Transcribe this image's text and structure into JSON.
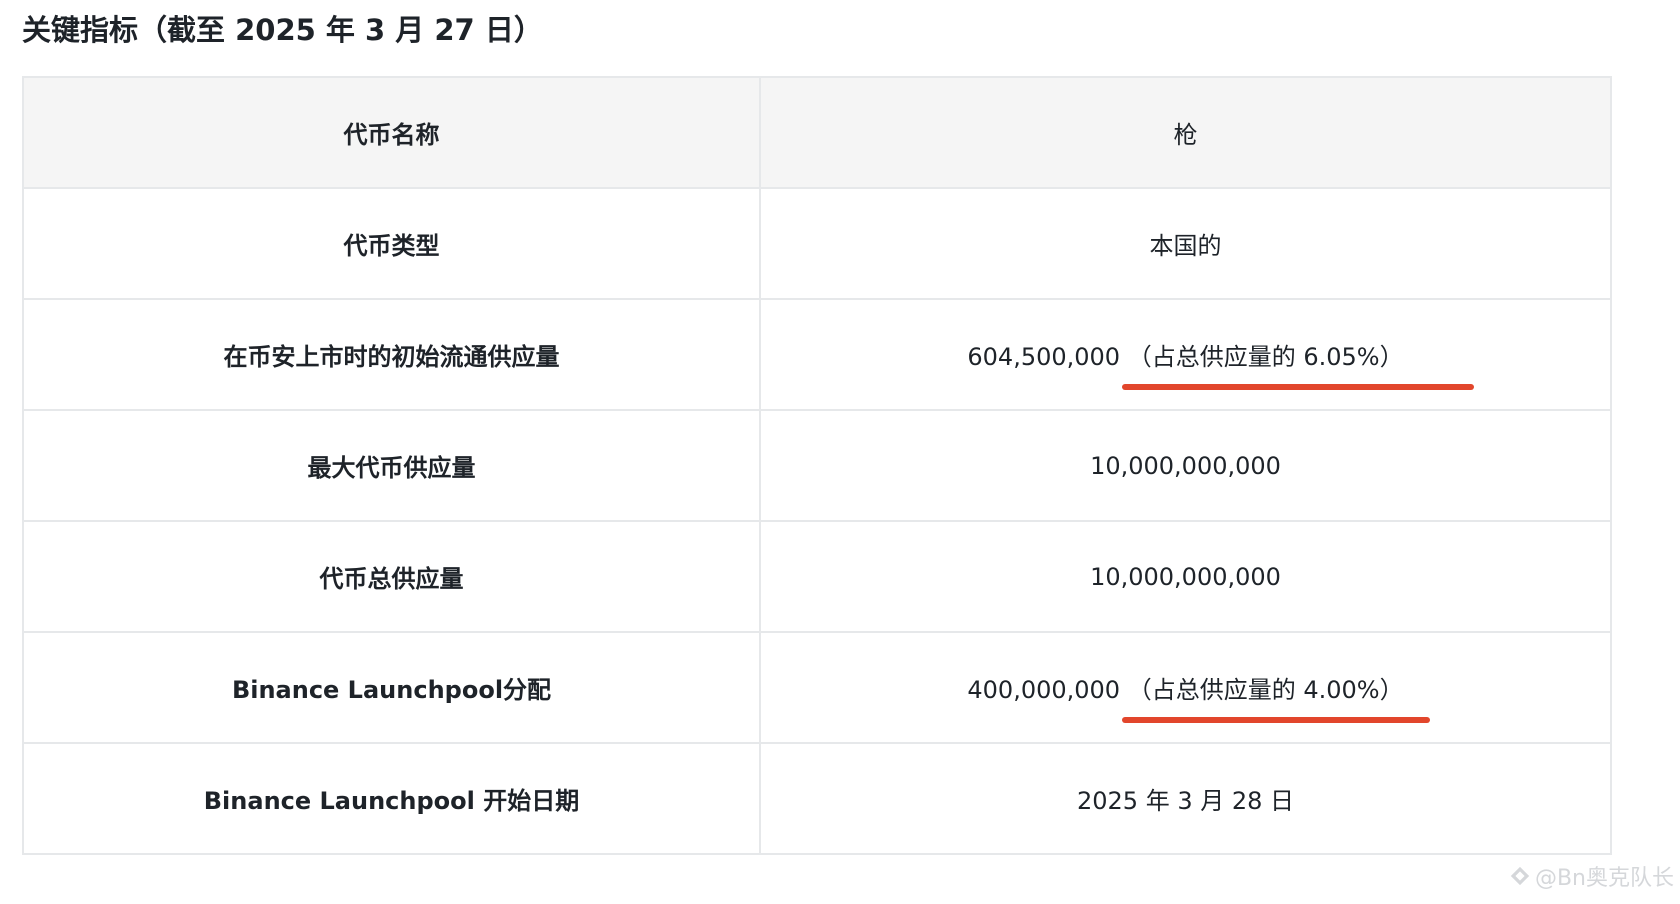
{
  "heading": "关键指标（截至 2025 年 3 月 27 日）",
  "table": {
    "header": {
      "label": "代币名称",
      "value": "枪"
    },
    "rows": [
      {
        "label": "代币类型",
        "value": "本国的",
        "note": ""
      },
      {
        "label": "在币安上市时的初始流通供应量",
        "value": "604,500,000",
        "note": "（占总供应量的 6.05%）"
      },
      {
        "label": "最大代币供应量",
        "value": "10,000,000,000",
        "note": ""
      },
      {
        "label": "代币总供应量",
        "value": "10,000,000,000",
        "note": ""
      },
      {
        "label": "Binance Launchpool分配",
        "value": "400,000,000",
        "note": "（占总供应量的 4.00%）"
      },
      {
        "label": "Binance Launchpool 开始日期",
        "value": "2025 年 3 月 28 日",
        "note": ""
      }
    ]
  },
  "watermark": {
    "text": "@Bn奥克队长",
    "icon": "diamond-logo-icon"
  },
  "colors": {
    "underline": "#e2462c",
    "header_bg": "#f5f5f5",
    "border": "#e6e8ea",
    "text": "#1e2329"
  }
}
